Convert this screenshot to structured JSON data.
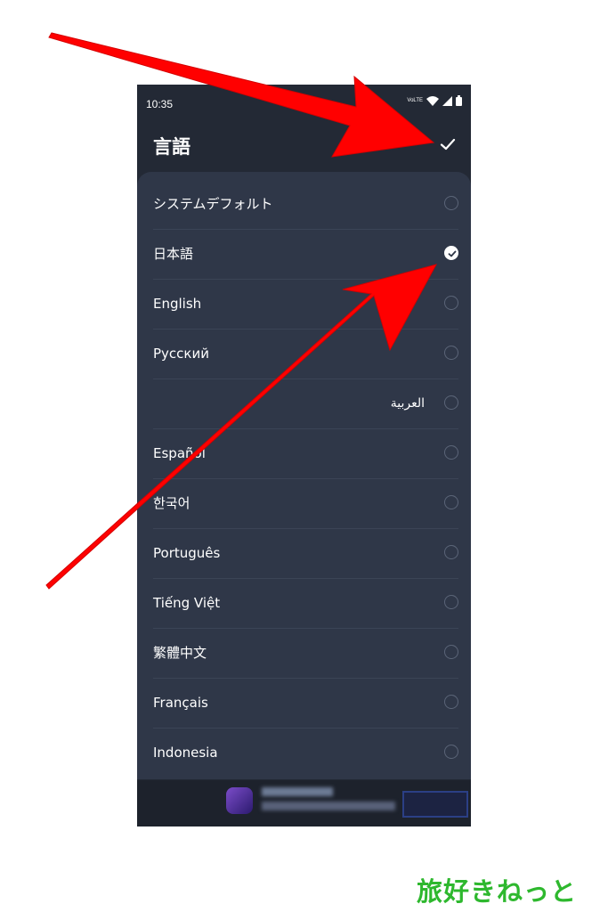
{
  "status_bar": {
    "time": "10:35",
    "network_label": "VoLTE"
  },
  "header": {
    "title": "言語",
    "confirm_icon": "check-icon"
  },
  "languages": [
    {
      "label": "システムデフォルト",
      "selected": false
    },
    {
      "label": "日本語",
      "selected": true
    },
    {
      "label": "English",
      "selected": false
    },
    {
      "label": "Русский",
      "selected": false
    },
    {
      "label": "العربية",
      "selected": false
    },
    {
      "label": "Español",
      "selected": false
    },
    {
      "label": "한국어",
      "selected": false
    },
    {
      "label": "Português",
      "selected": false
    },
    {
      "label": "Tiếng Việt",
      "selected": false
    },
    {
      "label": "繁體中文",
      "selected": false
    },
    {
      "label": "Français",
      "selected": false
    },
    {
      "label": "Indonesia",
      "selected": false
    }
  ],
  "watermark": "旅好きねっと",
  "colors": {
    "annotation_arrow": "#ff0000",
    "brand": "#2eb82e",
    "background": "#232935",
    "sheet": "#2f3748"
  }
}
